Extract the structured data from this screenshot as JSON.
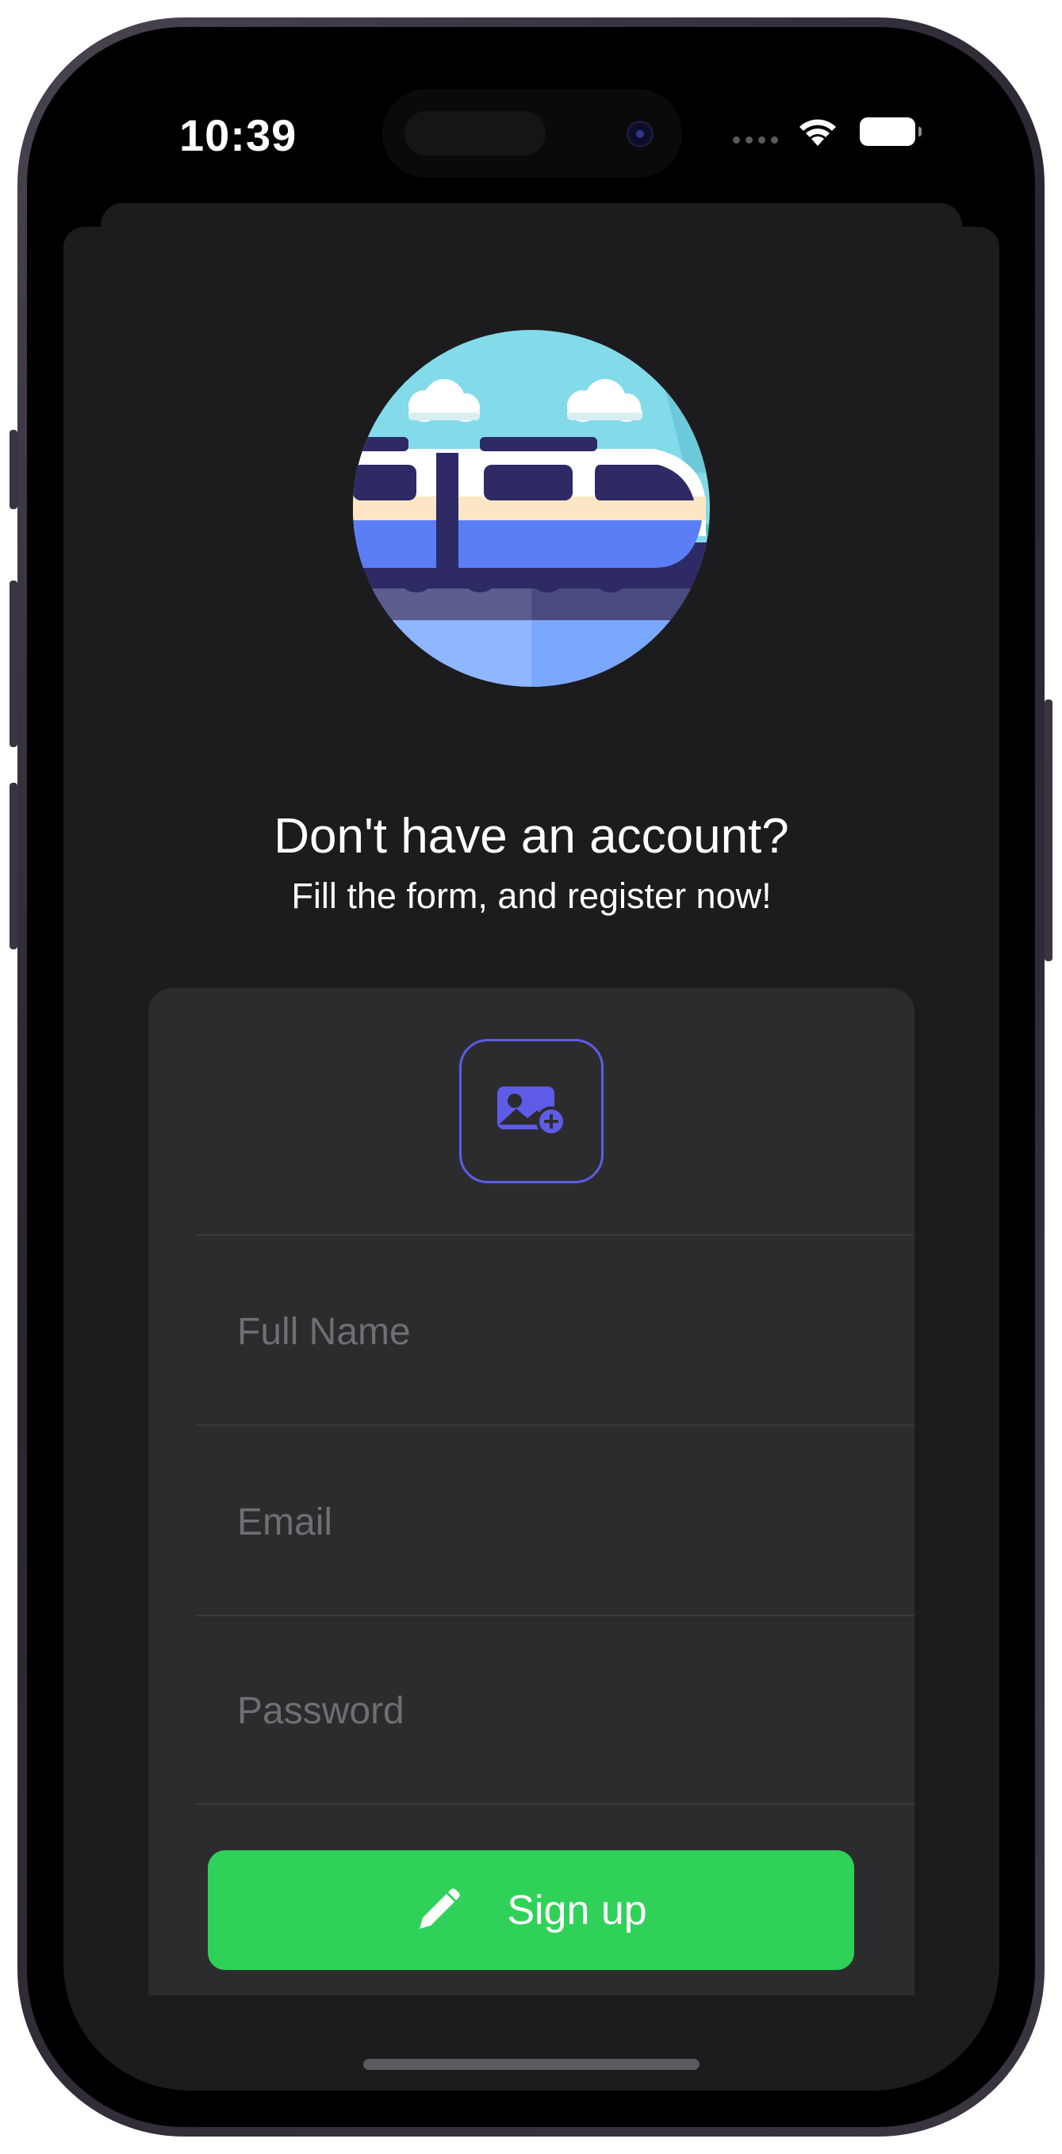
{
  "status_bar": {
    "time": "10:39"
  },
  "header": {
    "title": "Don't have an account?",
    "subtitle": "Fill the form, and register now!"
  },
  "form": {
    "full_name": {
      "placeholder": "Full Name",
      "value": ""
    },
    "email": {
      "placeholder": "Email",
      "value": ""
    },
    "password": {
      "placeholder": "Password",
      "value": ""
    },
    "signup_label": "Sign up"
  },
  "icons": {
    "hero": "train-illustration",
    "photo": "add-photo-icon",
    "signup": "pencil-icon"
  },
  "colors": {
    "background": "#1c1c1e",
    "card": "#2c2c2e",
    "accent": "#5e5ce6",
    "button": "#30d158",
    "placeholder": "#6e6e73"
  }
}
